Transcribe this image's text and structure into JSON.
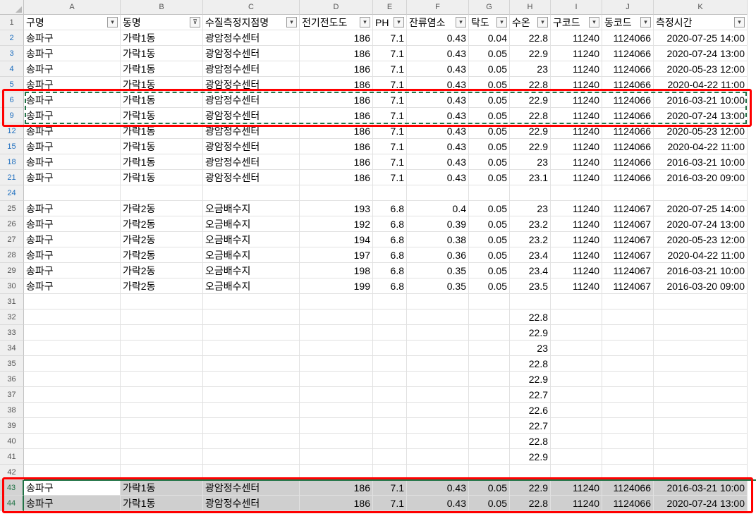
{
  "columns": [
    "A",
    "B",
    "C",
    "D",
    "E",
    "F",
    "G",
    "H",
    "I",
    "J",
    "K"
  ],
  "header_row": {
    "row_number": "1",
    "cells": [
      "구명",
      "동명",
      "수질측정지점명",
      "전기전도도",
      "PH",
      "잔류염소",
      "탁도",
      "수온",
      "구코드",
      "동코드",
      "측정시간"
    ]
  },
  "filter_icons": {
    "normal": "▾",
    "active": "⊽"
  },
  "rows": [
    {
      "n": "2",
      "cells": [
        "송파구",
        "가락1동",
        "광암정수센터",
        "186",
        "7.1",
        "0.43",
        "0.04",
        "22.8",
        "11240",
        "1124066",
        "2020-07-25 14:00"
      ]
    },
    {
      "n": "3",
      "cells": [
        "송파구",
        "가락1동",
        "광암정수센터",
        "186",
        "7.1",
        "0.43",
        "0.05",
        "22.9",
        "11240",
        "1124066",
        "2020-07-24 13:00"
      ]
    },
    {
      "n": "4",
      "cells": [
        "송파구",
        "가락1동",
        "광암정수센터",
        "186",
        "7.1",
        "0.43",
        "0.05",
        "23",
        "11240",
        "1124066",
        "2020-05-23 12:00"
      ]
    },
    {
      "n": "5",
      "cells": [
        "송파구",
        "가락1동",
        "광암정수센터",
        "186",
        "7.1",
        "0.43",
        "0.05",
        "22.8",
        "11240",
        "1124066",
        "2020-04-22 11:00"
      ]
    },
    {
      "n": "6",
      "cells": [
        "송파구",
        "가락1동",
        "광암정수센터",
        "186",
        "7.1",
        "0.43",
        "0.05",
        "22.9",
        "11240",
        "1124066",
        "2016-03-21 10:00"
      ]
    },
    {
      "n": "9",
      "cells": [
        "송파구",
        "가락1동",
        "광암정수센터",
        "186",
        "7.1",
        "0.43",
        "0.05",
        "22.8",
        "11240",
        "1124066",
        "2020-07-24 13:00"
      ]
    },
    {
      "n": "12",
      "cells": [
        "송파구",
        "가락1동",
        "광암정수센터",
        "186",
        "7.1",
        "0.43",
        "0.05",
        "22.9",
        "11240",
        "1124066",
        "2020-05-23 12:00"
      ]
    },
    {
      "n": "15",
      "cells": [
        "송파구",
        "가락1동",
        "광암정수센터",
        "186",
        "7.1",
        "0.43",
        "0.05",
        "22.9",
        "11240",
        "1124066",
        "2020-04-22 11:00"
      ]
    },
    {
      "n": "18",
      "cells": [
        "송파구",
        "가락1동",
        "광암정수센터",
        "186",
        "7.1",
        "0.43",
        "0.05",
        "23",
        "11240",
        "1124066",
        "2016-03-21 10:00"
      ]
    },
    {
      "n": "21",
      "cells": [
        "송파구",
        "가락1동",
        "광암정수센터",
        "186",
        "7.1",
        "0.43",
        "0.05",
        "23.1",
        "11240",
        "1124066",
        "2016-03-20 09:00"
      ]
    },
    {
      "n": "24",
      "cells": [
        "",
        "",
        "",
        "",
        "",
        "",
        "",
        "",
        "",
        "",
        ""
      ]
    },
    {
      "n": "25",
      "cells": [
        "송파구",
        "가락2동",
        "오금배수지",
        "193",
        "6.8",
        "0.4",
        "0.05",
        "23",
        "11240",
        "1124067",
        "2020-07-25 14:00"
      ]
    },
    {
      "n": "26",
      "cells": [
        "송파구",
        "가락2동",
        "오금배수지",
        "192",
        "6.8",
        "0.39",
        "0.05",
        "23.2",
        "11240",
        "1124067",
        "2020-07-24 13:00"
      ]
    },
    {
      "n": "27",
      "cells": [
        "송파구",
        "가락2동",
        "오금배수지",
        "194",
        "6.8",
        "0.38",
        "0.05",
        "23.2",
        "11240",
        "1124067",
        "2020-05-23 12:00"
      ]
    },
    {
      "n": "28",
      "cells": [
        "송파구",
        "가락2동",
        "오금배수지",
        "197",
        "6.8",
        "0.36",
        "0.05",
        "23.4",
        "11240",
        "1124067",
        "2020-04-22 11:00"
      ]
    },
    {
      "n": "29",
      "cells": [
        "송파구",
        "가락2동",
        "오금배수지",
        "198",
        "6.8",
        "0.35",
        "0.05",
        "23.4",
        "11240",
        "1124067",
        "2016-03-21 10:00"
      ]
    },
    {
      "n": "30",
      "cells": [
        "송파구",
        "가락2동",
        "오금배수지",
        "199",
        "6.8",
        "0.35",
        "0.05",
        "23.5",
        "11240",
        "1124067",
        "2016-03-20 09:00"
      ]
    },
    {
      "n": "31",
      "cells": [
        "",
        "",
        "",
        "",
        "",
        "",
        "",
        "",
        "",
        "",
        ""
      ]
    },
    {
      "n": "32",
      "cells": [
        "",
        "",
        "",
        "",
        "",
        "",
        "",
        "22.8",
        "",
        "",
        ""
      ]
    },
    {
      "n": "33",
      "cells": [
        "",
        "",
        "",
        "",
        "",
        "",
        "",
        "22.9",
        "",
        "",
        ""
      ]
    },
    {
      "n": "34",
      "cells": [
        "",
        "",
        "",
        "",
        "",
        "",
        "",
        "23",
        "",
        "",
        ""
      ]
    },
    {
      "n": "35",
      "cells": [
        "",
        "",
        "",
        "",
        "",
        "",
        "",
        "22.8",
        "",
        "",
        ""
      ]
    },
    {
      "n": "36",
      "cells": [
        "",
        "",
        "",
        "",
        "",
        "",
        "",
        "22.9",
        "",
        "",
        ""
      ]
    },
    {
      "n": "37",
      "cells": [
        "",
        "",
        "",
        "",
        "",
        "",
        "",
        "22.7",
        "",
        "",
        ""
      ]
    },
    {
      "n": "38",
      "cells": [
        "",
        "",
        "",
        "",
        "",
        "",
        "",
        "22.6",
        "",
        "",
        ""
      ]
    },
    {
      "n": "39",
      "cells": [
        "",
        "",
        "",
        "",
        "",
        "",
        "",
        "22.7",
        "",
        "",
        ""
      ]
    },
    {
      "n": "40",
      "cells": [
        "",
        "",
        "",
        "",
        "",
        "",
        "",
        "22.8",
        "",
        "",
        ""
      ]
    },
    {
      "n": "41",
      "cells": [
        "",
        "",
        "",
        "",
        "",
        "",
        "",
        "22.9",
        "",
        "",
        ""
      ]
    },
    {
      "n": "42",
      "cells": [
        "",
        "",
        "",
        "",
        "",
        "",
        "",
        "",
        "",
        "",
        ""
      ]
    },
    {
      "n": "43",
      "cells": [
        "송파구",
        "가락1동",
        "광암정수센터",
        "186",
        "7.1",
        "0.43",
        "0.05",
        "22.9",
        "11240",
        "1124066",
        "2016-03-21 10:00"
      ]
    },
    {
      "n": "44",
      "cells": [
        "송파구",
        "가락1동",
        "광암정수센터",
        "186",
        "7.1",
        "0.43",
        "0.05",
        "22.8",
        "11240",
        "1124066",
        "2020-07-24 13:00"
      ]
    }
  ],
  "filtered_row_numbers": [
    "2",
    "3",
    "4",
    "5",
    "6",
    "9",
    "12",
    "15",
    "18",
    "21",
    "24"
  ],
  "copied_range_rows": [
    "6",
    "9"
  ],
  "selected_range_rows": [
    "43",
    "44"
  ],
  "active_cell": "A43",
  "colors": {
    "selection_green": "#217346",
    "highlight_red": "#ff0000",
    "filtered_row_number_blue": "#1f6fbf",
    "selection_gray": "#cfcfcf"
  }
}
